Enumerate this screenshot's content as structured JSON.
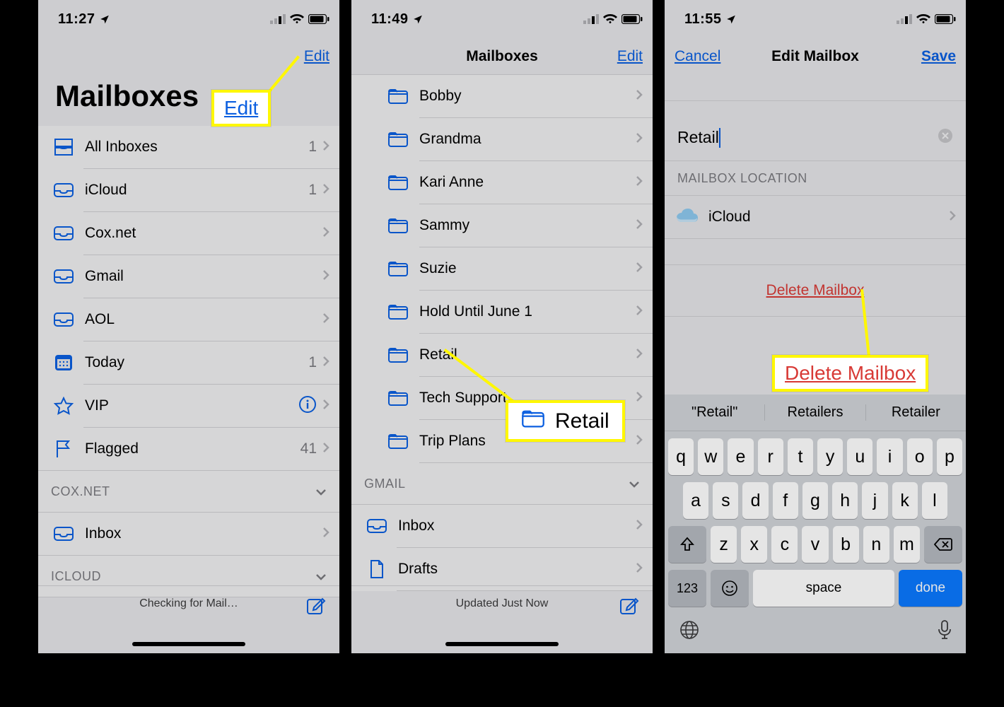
{
  "phone1": {
    "time": "11:27",
    "title": "Mailboxes",
    "edit": "Edit",
    "rows": [
      {
        "label": "All Inboxes",
        "count": "1"
      },
      {
        "label": "iCloud",
        "count": "1"
      },
      {
        "label": "Cox.net",
        "count": ""
      },
      {
        "label": "Gmail",
        "count": ""
      },
      {
        "label": "AOL",
        "count": ""
      },
      {
        "label": "Today",
        "count": "1"
      },
      {
        "label": "VIP",
        "count": ""
      },
      {
        "label": "Flagged",
        "count": "41"
      }
    ],
    "sections": {
      "cox": "COX.NET",
      "icloud": "ICLOUD"
    },
    "inbox": "Inbox",
    "status": "Checking for Mail…",
    "callout": "Edit"
  },
  "phone2": {
    "time": "11:49",
    "title": "Mailboxes",
    "edit": "Edit",
    "folders": [
      "Bobby",
      "Grandma",
      "Kari Anne",
      "Sammy",
      "Suzie",
      "Hold Until June 1",
      "Retail",
      "Tech Support",
      "Trip Plans"
    ],
    "gmail_header": "GMAIL",
    "gmail_rows": {
      "inbox": "Inbox",
      "drafts": "Drafts"
    },
    "status": "Updated Just Now",
    "callout": "Retail"
  },
  "phone3": {
    "time": "11:55",
    "nav": {
      "cancel": "Cancel",
      "title": "Edit Mailbox",
      "save": "Save"
    },
    "field_value": "Retail",
    "loc_header": "MAILBOX LOCATION",
    "loc_value": "iCloud",
    "delete": "Delete Mailbox",
    "callout": "Delete Mailbox",
    "kb": {
      "suggestions": [
        "\"Retail\"",
        "Retailers",
        "Retailer"
      ],
      "r1": [
        "q",
        "w",
        "e",
        "r",
        "t",
        "y",
        "u",
        "i",
        "o",
        "p"
      ],
      "r2": [
        "a",
        "s",
        "d",
        "f",
        "g",
        "h",
        "j",
        "k",
        "l"
      ],
      "r3": [
        "z",
        "x",
        "c",
        "v",
        "b",
        "n",
        "m"
      ],
      "num": "123",
      "space": "space",
      "done": "done"
    }
  }
}
